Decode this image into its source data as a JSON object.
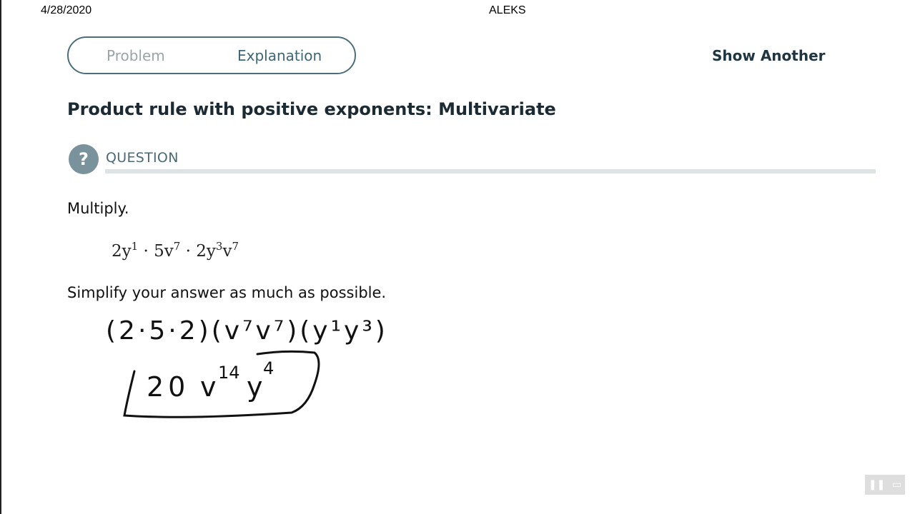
{
  "print_header": {
    "date": "4/28/2020",
    "title": "ALEKS"
  },
  "tabs": [
    {
      "label": "Problem",
      "active": false
    },
    {
      "label": "Explanation",
      "active": true
    }
  ],
  "show_another_label": "Show Another",
  "page_title": "Product rule with positive exponents: Multivariate",
  "question": {
    "badge": "?",
    "label": "QUESTION"
  },
  "instruction": "Multiply.",
  "expression": {
    "t1": "2y",
    "e1": "1",
    "dot1": "·",
    "t2": "5v",
    "e2": "7",
    "dot2": "·",
    "t3": "2y",
    "e3": "3",
    "t4": "v",
    "e4": "7"
  },
  "simplify_text": "Simplify your answer as much as possible.",
  "handwriting": {
    "line1": "(2·5·2)(v⁷v⁷)(y¹y³)",
    "answer_coef": "20",
    "answer_v": "v",
    "answer_v_exp": "14",
    "answer_y": "y",
    "answer_y_exp": "4"
  },
  "player": {
    "pause_icon": "pause-icon",
    "screen_icon": "screen-icon"
  },
  "colors": {
    "tab_border": "#4d6f7a",
    "badge": "#7a929c",
    "rule": "#dde2e5"
  }
}
